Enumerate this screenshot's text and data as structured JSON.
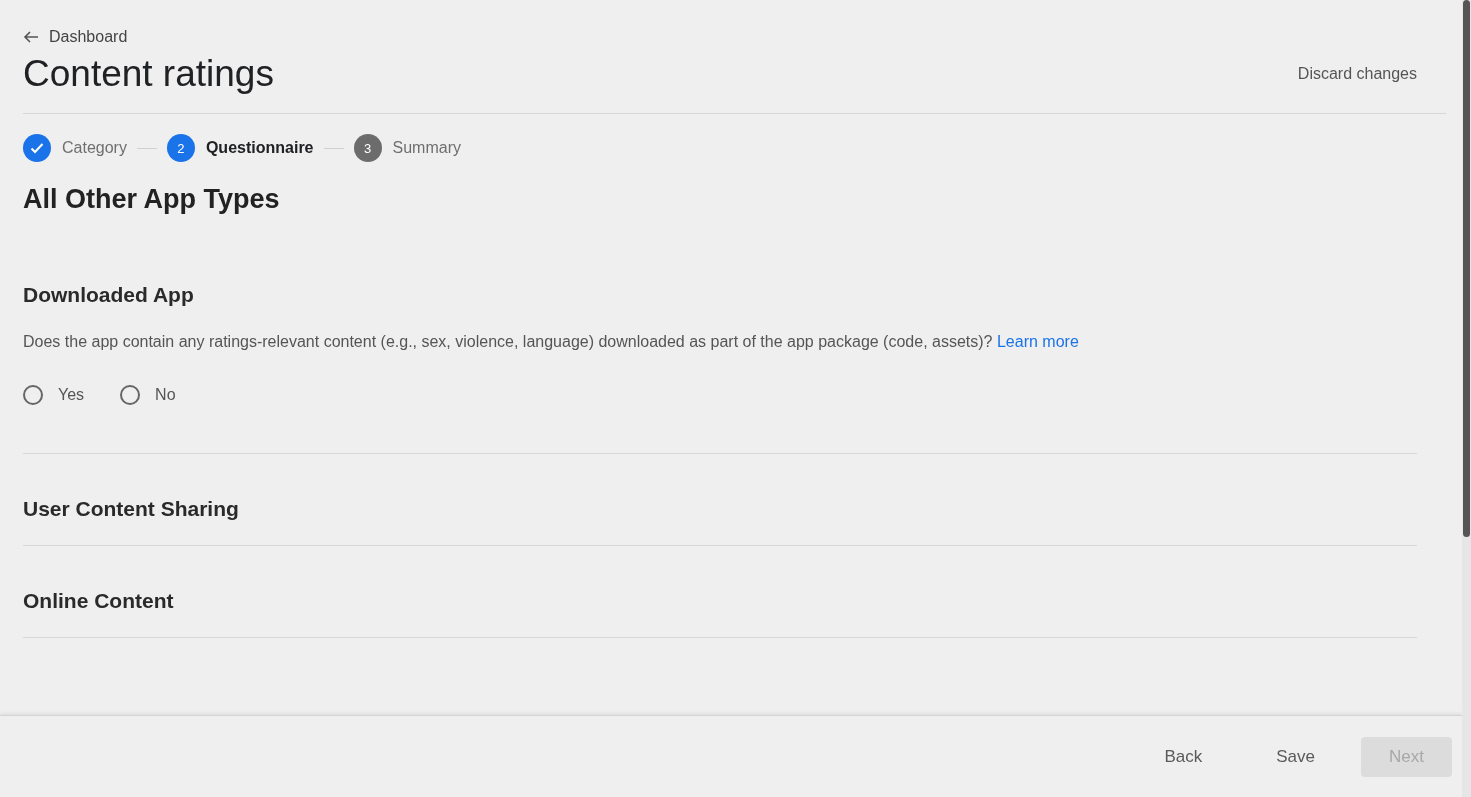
{
  "back_link": "Dashboard",
  "title": "Content ratings",
  "discard_button": "Discard changes",
  "steps": [
    {
      "label": "Category",
      "done": true,
      "selected": false
    },
    {
      "label": "Questionnaire",
      "number": "2",
      "done": false,
      "selected": true
    },
    {
      "label": "Summary",
      "number": "3",
      "done": false,
      "selected": false
    }
  ],
  "section_title": "All Other App Types",
  "questions": [
    {
      "title": "Downloaded App",
      "expanded": true,
      "text": "Does the app contain any ratings-relevant content (e.g., sex, violence, language) downloaded as part of the app package (code, assets)?",
      "link": "Learn more",
      "options": [
        {
          "label": "Yes",
          "selected": false
        },
        {
          "label": "No",
          "selected": false
        }
      ]
    },
    {
      "title": "User Content Sharing",
      "expanded": false
    },
    {
      "title": "Online Content",
      "expanded": false
    }
  ],
  "footer": {
    "buttons": [
      {
        "label": "Back",
        "disabled": false
      },
      {
        "label": "Save",
        "disabled": false
      },
      {
        "label": "Next",
        "disabled": true
      }
    ]
  }
}
